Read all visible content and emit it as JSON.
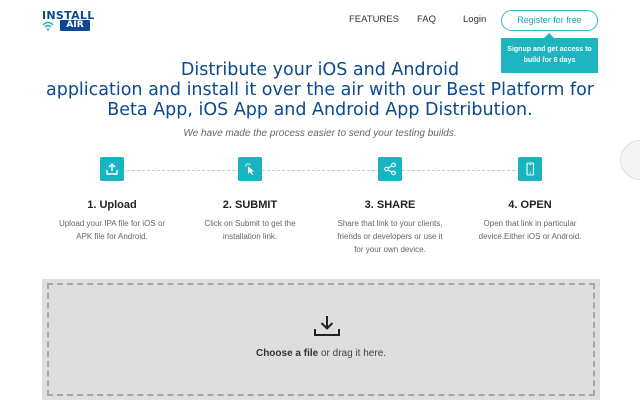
{
  "header": {
    "logo_top": "INSTALL",
    "logo_bottom": "AIR",
    "nav": {
      "features": "FEATURES",
      "faq": "FAQ",
      "login": "Login"
    },
    "register_label": "Register for free",
    "tooltip": "Signup and get access to build for 8 days"
  },
  "hero": {
    "title_line1": "Distribute your iOS and Android",
    "title_line2": "application and install it over the air with our Best Platform for",
    "title_line3": "Beta App, iOS App and Android App Distribution.",
    "subtitle": "We have made the process easier to send your testing builds."
  },
  "steps": [
    {
      "title": "1. Upload",
      "desc": "Upload your IPA file for iOS or APK file for Android.",
      "icon": "upload-icon"
    },
    {
      "title": "2. SUBMIT",
      "desc": "Click on Submit to get the installation link.",
      "icon": "cursor-click-icon"
    },
    {
      "title": "3. SHARE",
      "desc": "Share that link to your clients, friends or developers or use it for your own device.",
      "icon": "share-icon"
    },
    {
      "title": "4. OPEN",
      "desc": "Open that link in particular device.Either iOS or Android.",
      "icon": "phone-icon"
    }
  ],
  "upload": {
    "choose_label": "Choose a file",
    "drag_label": " or drag it here."
  },
  "colors": {
    "brand_blue": "#0b4a8f",
    "accent_teal": "#19b4bf"
  }
}
